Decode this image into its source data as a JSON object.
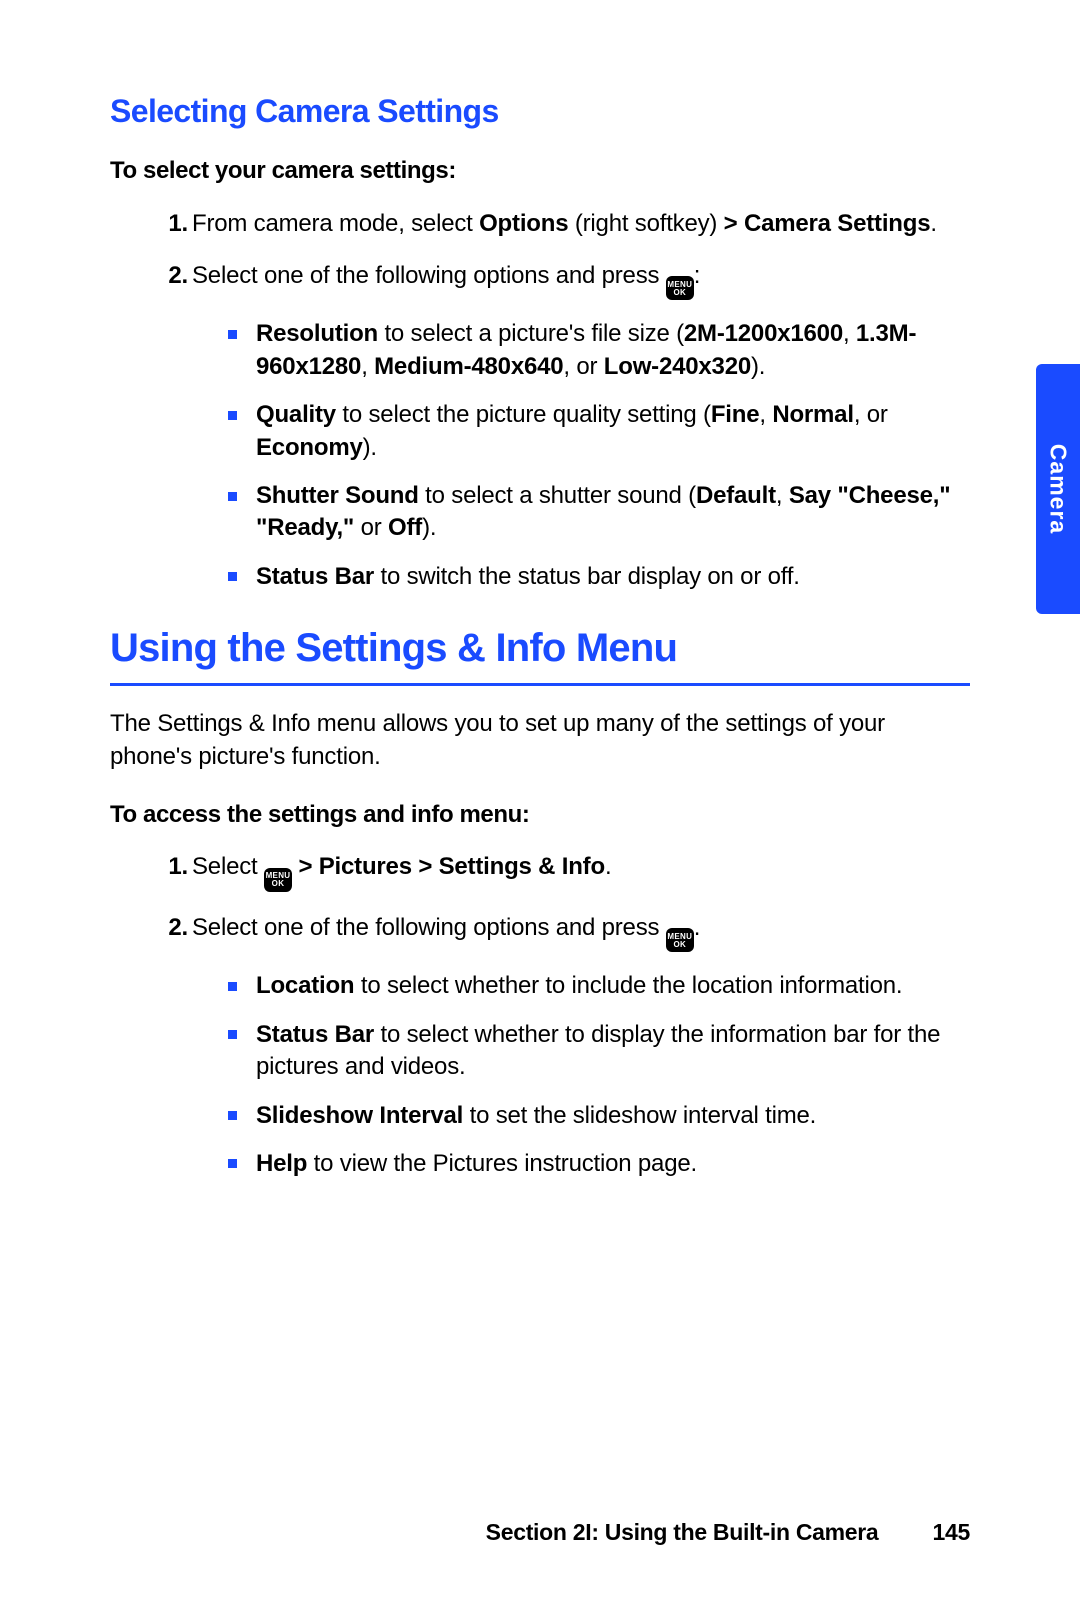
{
  "side_tab": {
    "label": "Camera"
  },
  "section1": {
    "heading": "Selecting Camera Settings",
    "lead": "To select your camera settings:",
    "step1": {
      "prefix": "From camera mode, select ",
      "bold1": "Options",
      "mid": " (right softkey) ",
      "bold2": "> Camera Settings",
      "suffix": "."
    },
    "step2": {
      "prefix": "Select one of the following options and press ",
      "suffix": ":"
    },
    "key": {
      "top": "MENU",
      "bottom": "OK"
    },
    "bullets": {
      "resolution": {
        "name": "Resolution",
        "mid1": " to select a picture's file size (",
        "v1": "2M-1200x1600",
        "c1": ", ",
        "v2": "1.3M-960x1280",
        "c2": ", ",
        "v3": "Medium-480x640",
        "c3": ", or ",
        "v4": "Low-240x320",
        "end": ")."
      },
      "quality": {
        "name": "Quality",
        "mid1": " to select the picture quality setting (",
        "v1": "Fine",
        "c1": ", ",
        "v2": "Normal",
        "c2": ", or ",
        "v3": "Economy",
        "end": ")."
      },
      "shutter": {
        "name": "Shutter Sound",
        "mid1": " to select a shutter sound (",
        "v1": "Default",
        "c1": ", ",
        "v2": "Say \"Cheese",
        "c2": ",\" \"",
        "v3": "Ready",
        "c3": ",\"",
        "c4": " or ",
        "v4": "Off",
        "end": ")."
      },
      "statusbar": {
        "name": "Status Bar",
        "rest": " to switch the status bar display on or off."
      }
    }
  },
  "section2": {
    "heading": "Using the Settings & Info Menu",
    "intro": "The Settings & Info menu allows you to set up many of the settings of your phone's picture's function.",
    "lead": "To access the settings and info menu:",
    "step1": {
      "prefix": "Select ",
      "bold_after": " > Pictures > Settings & Info",
      "suffix": "."
    },
    "step2": {
      "prefix": "Select one of the following options and press ",
      "suffix": "."
    },
    "bullets": {
      "location": {
        "name": "Location",
        "rest": " to select whether to include the location information."
      },
      "statusbar": {
        "name": "Status Bar",
        "rest": " to select whether to display the information bar for the pictures and videos."
      },
      "slideshow": {
        "name": "Slideshow Interval",
        "rest": " to set the slideshow interval time."
      },
      "help": {
        "name": "Help",
        "rest": " to view the Pictures instruction page."
      }
    }
  },
  "footer": {
    "section_label": "Section 2I: Using the Built-in Camera",
    "page_number": "145"
  }
}
